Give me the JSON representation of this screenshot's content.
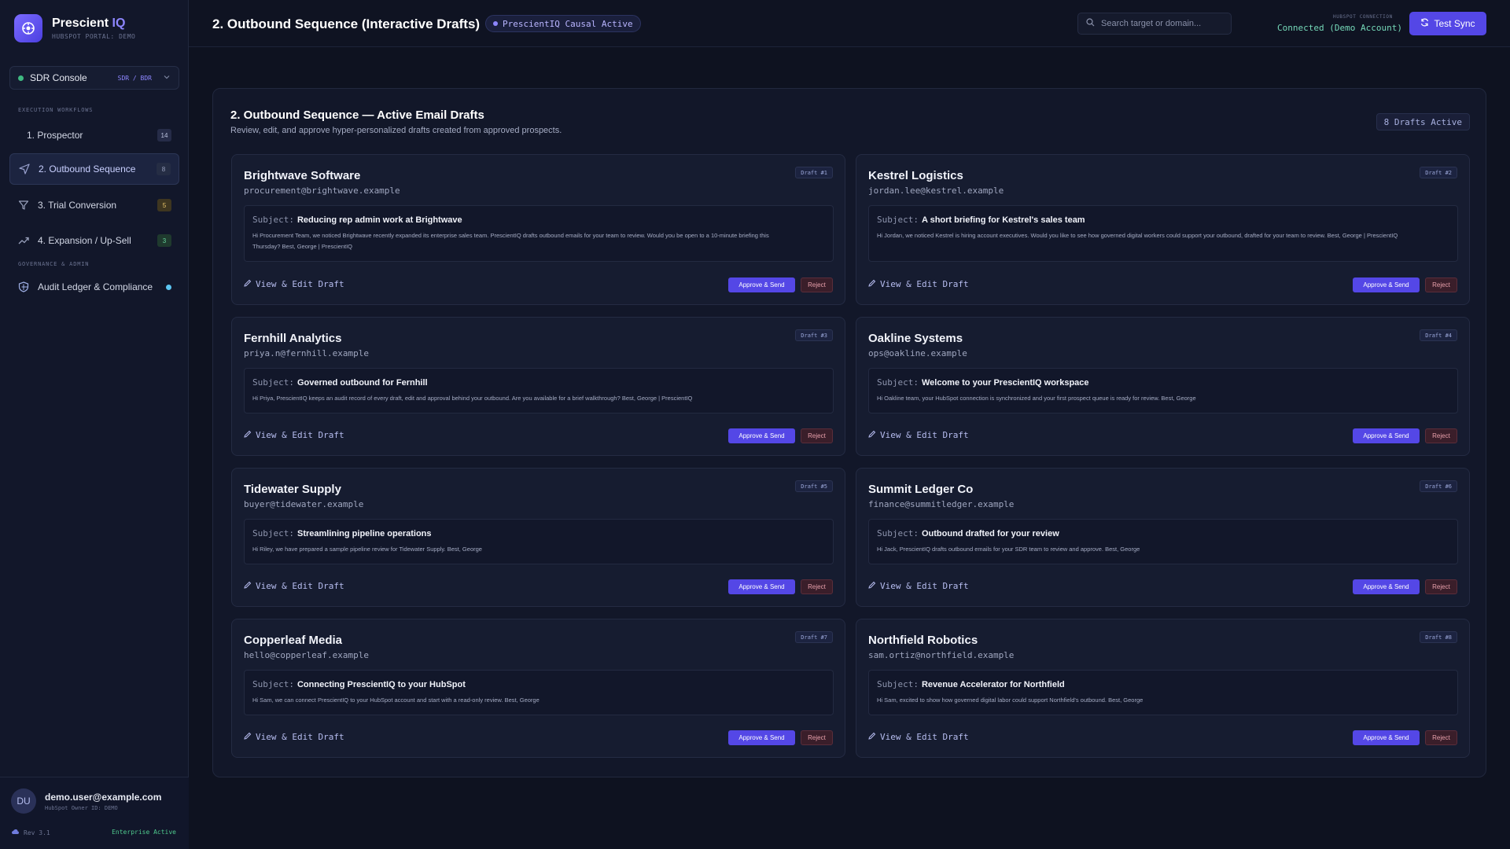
{
  "brand": {
    "name": "Prescient",
    "name_suffix": "IQ",
    "portal": "HUBSPOT PORTAL: DEMO"
  },
  "sidebar": {
    "console": {
      "label": "SDR Console",
      "role": "SDR / BDR"
    },
    "section_workflows": "EXECUTION WORKFLOWS",
    "section_governance": "GOVERNANCE & ADMIN",
    "items": [
      {
        "label": "1. Prospector",
        "count": "14",
        "icon": "none"
      },
      {
        "label": "2. Outbound Sequence",
        "count": "8",
        "icon": "send-icon"
      },
      {
        "label": "3. Trial Conversion",
        "count": "5",
        "icon": "filter-icon"
      },
      {
        "label": "4. Expansion / Up-Sell",
        "count": "3",
        "icon": "trending-up-icon"
      },
      {
        "label": "Audit Ledger & Compliance",
        "icon": "shield-icon"
      }
    ],
    "user": {
      "initials": "DU",
      "email": "demo.user@example.com",
      "owner": "HubSpot Owner ID: DEMO",
      "rev": "Rev 3.1",
      "plan": "Enterprise Active"
    }
  },
  "header": {
    "title": "2. Outbound Sequence (Interactive Drafts)",
    "pill": "PrescientIQ Causal Active",
    "search_placeholder": "Search target or domain...",
    "hubspot_label": "HUBSPOT CONNECTION",
    "hubspot_status": "Connected (Demo Account)",
    "sync_label": "Test Sync"
  },
  "panel": {
    "title": "2. Outbound Sequence — Active Email Drafts",
    "subtitle": "Review, edit, and approve hyper-personalized drafts created from approved prospects.",
    "count_label": "8 Drafts Active",
    "subject_prefix": "Subject:",
    "edit_label": "View & Edit Draft",
    "approve_label": "Approve & Send",
    "reject_label": "Reject"
  },
  "drafts": [
    {
      "company": "Brightwave Software",
      "email": "procurement@brightwave.example",
      "tag": "Draft #1",
      "subject": "Reducing rep admin work at Brightwave",
      "body": "Hi Procurement Team, we noticed Brightwave recently expanded its enterprise sales team. PrescientIQ drafts outbound emails for your team to review. Would you be open to a 10-minute briefing this Thursday? Best, George | PrescientIQ"
    },
    {
      "company": "Kestrel Logistics",
      "email": "jordan.lee@kestrel.example",
      "tag": "Draft #2",
      "subject": "A short briefing for Kestrel's sales team",
      "body": "Hi Jordan, we noticed Kestrel is hiring account executives. Would you like to see how governed digital workers could support your outbound, drafted for your team to review. Best, George | PrescientIQ"
    },
    {
      "company": "Fernhill Analytics",
      "email": "priya.n@fernhill.example",
      "tag": "Draft #3",
      "subject": "Governed outbound for Fernhill",
      "body": "Hi Priya, PrescientIQ keeps an audit record of every draft, edit and approval behind your outbound. Are you available for a brief walkthrough? Best, George | PrescientIQ"
    },
    {
      "company": "Oakline Systems",
      "email": "ops@oakline.example",
      "tag": "Draft #4",
      "subject": "Welcome to your PrescientIQ workspace",
      "body": "Hi Oakline team, your HubSpot connection is synchronized and your first prospect queue is ready for review. Best, George"
    },
    {
      "company": "Tidewater Supply",
      "email": "buyer@tidewater.example",
      "tag": "Draft #5",
      "subject": "Streamlining pipeline operations",
      "body": "Hi Riley, we have prepared a sample pipeline review for Tidewater Supply. Best, George"
    },
    {
      "company": "Summit Ledger Co",
      "email": "finance@summitledger.example",
      "tag": "Draft #6",
      "subject": "Outbound drafted for your review",
      "body": "Hi Jack, PrescientIQ drafts outbound emails for your SDR team to review and approve. Best, George"
    },
    {
      "company": "Copperleaf Media",
      "email": "hello@copperleaf.example",
      "tag": "Draft #7",
      "subject": "Connecting PrescientIQ to your HubSpot",
      "body": "Hi Sam, we can connect PrescientIQ to your HubSpot account and start with a read-only review. Best, George"
    },
    {
      "company": "Northfield Robotics",
      "email": "sam.ortiz@northfield.example",
      "tag": "Draft #8",
      "subject": "Revenue Accelerator for Northfield",
      "body": "Hi Sam, excited to show how governed digital labor could support Northfield's outbound. Best, George"
    }
  ],
  "colors": {
    "accent": "#5447e6",
    "bg": "#0e1220",
    "success": "#3fb981",
    "danger": "#e8a0ab"
  }
}
